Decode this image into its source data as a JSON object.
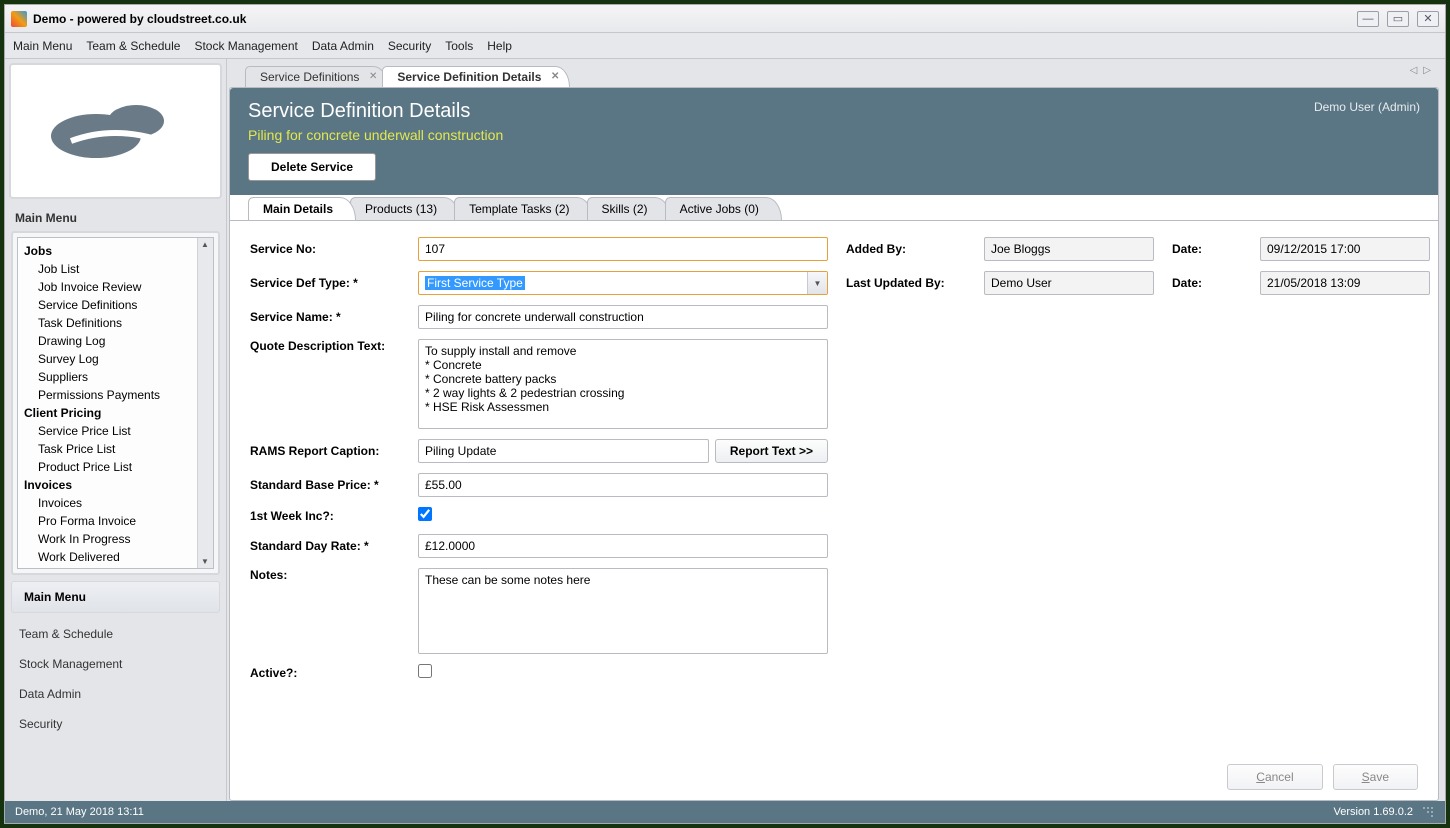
{
  "window": {
    "title": "Demo - powered by cloudstreet.co.uk"
  },
  "menubar": [
    "Main Menu",
    "Team & Schedule",
    "Stock Management",
    "Data Admin",
    "Security",
    "Tools",
    "Help"
  ],
  "sidebar": {
    "header": "Main Menu",
    "tree": [
      {
        "type": "cat",
        "label": "Jobs"
      },
      {
        "type": "item",
        "label": "Job List"
      },
      {
        "type": "item",
        "label": "Job Invoice Review"
      },
      {
        "type": "item",
        "label": "Service Definitions"
      },
      {
        "type": "item",
        "label": "Task Definitions"
      },
      {
        "type": "item",
        "label": "Drawing Log"
      },
      {
        "type": "item",
        "label": "Survey Log"
      },
      {
        "type": "item",
        "label": "Suppliers"
      },
      {
        "type": "item",
        "label": "Permissions Payments"
      },
      {
        "type": "cat",
        "label": "Client Pricing"
      },
      {
        "type": "item",
        "label": "Service Price List"
      },
      {
        "type": "item",
        "label": "Task Price List"
      },
      {
        "type": "item",
        "label": "Product Price List"
      },
      {
        "type": "cat",
        "label": "Invoices"
      },
      {
        "type": "item",
        "label": "Invoices"
      },
      {
        "type": "item",
        "label": "Pro Forma Invoice"
      },
      {
        "type": "item",
        "label": "Work In Progress"
      },
      {
        "type": "item",
        "label": "Work Delivered"
      }
    ],
    "sections": {
      "main_menu": "Main Menu",
      "links": [
        "Team & Schedule",
        "Stock Management",
        "Data Admin",
        "Security"
      ]
    }
  },
  "doc_tabs": [
    {
      "label": "Service Definitions",
      "active": false
    },
    {
      "label": "Service Definition Details",
      "active": true
    }
  ],
  "header": {
    "title": "Service Definition Details",
    "subtitle": "Piling for concrete underwall construction",
    "user_info": "Demo User (Admin)",
    "delete_btn": "Delete Service"
  },
  "inner_tabs": [
    "Main Details",
    "Products (13)",
    "Template Tasks (2)",
    "Skills (2)",
    "Active Jobs (0)"
  ],
  "form": {
    "service_no_label": "Service No:",
    "service_no": "107",
    "service_def_type_label": "Service Def Type: *",
    "service_def_type": "First Service Type",
    "service_name_label": "Service Name: *",
    "service_name": "Piling for concrete underwall construction",
    "quote_desc_label": "Quote Description Text:",
    "quote_desc": "To supply install and remove\n* Concrete\n* Concrete battery packs\n* 2 way lights & 2 pedestrian crossing\n* HSE Risk Assessmen",
    "rams_label": "RAMS Report Caption:",
    "rams_value": "Piling Update",
    "report_text_btn": "Report Text >>",
    "std_base_price_label": "Standard Base Price: *",
    "std_base_price": "£55.00",
    "first_week_label": "1st Week Inc?:",
    "first_week_checked": true,
    "std_day_rate_label": "Standard Day Rate: *",
    "std_day_rate": "£12.0000",
    "notes_label": "Notes:",
    "notes": "These can be some notes here",
    "active_label": "Active?:",
    "active_checked": false,
    "added_by_label": "Added By:",
    "added_by": "Joe Bloggs",
    "added_date_label": "Date:",
    "added_date": "09/12/2015 17:00",
    "updated_by_label": "Last Updated By:",
    "updated_by": "Demo User",
    "updated_date_label": "Date:",
    "updated_date": "21/05/2018 13:09"
  },
  "buttons": {
    "cancel": "Cancel",
    "save": "Save"
  },
  "statusbar": {
    "left": "Demo, 21 May 2018 13:11",
    "right": "Version 1.69.0.2"
  }
}
